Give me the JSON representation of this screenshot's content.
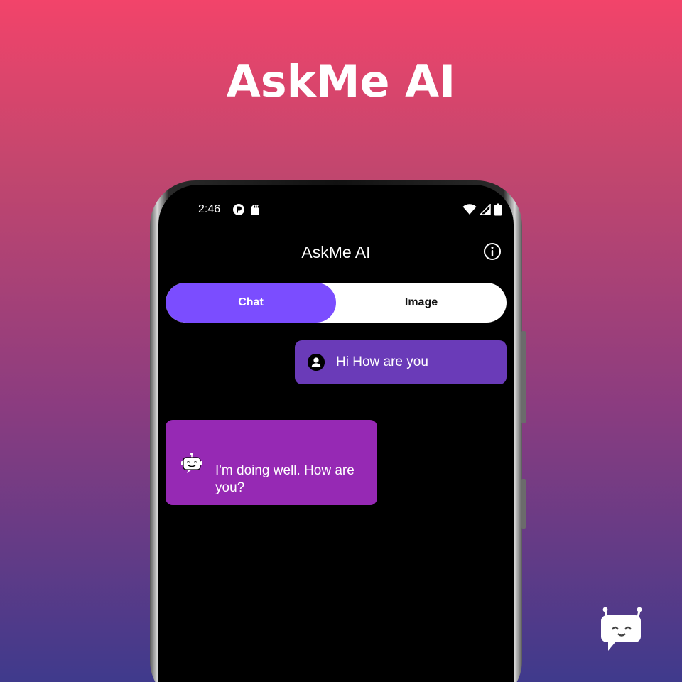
{
  "promo": {
    "title": "AskMe AI"
  },
  "statusbar": {
    "time": "2:46"
  },
  "appbar": {
    "title": "AskMe AI"
  },
  "tabs": [
    {
      "label": "Chat",
      "active": true
    },
    {
      "label": "Image",
      "active": false
    }
  ],
  "messages": [
    {
      "sender": "user",
      "text": "Hi How are you"
    },
    {
      "sender": "bot",
      "text": "I'm doing well. How are you?"
    }
  ],
  "colors": {
    "active_tab": "#7b4dff",
    "user_bubble": "#6a3bb8",
    "bot_bubble": "#9629b4"
  }
}
